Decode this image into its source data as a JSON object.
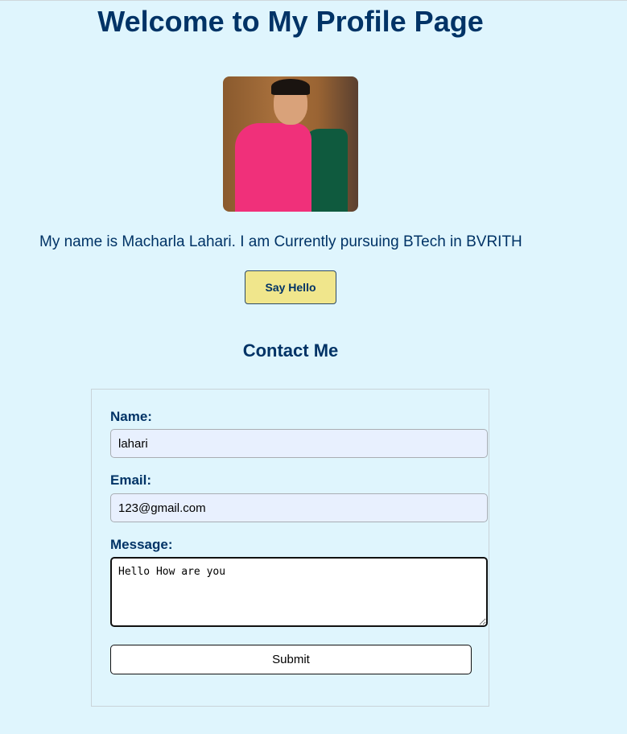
{
  "header": {
    "title": "Welcome to My Profile Page"
  },
  "profile": {
    "photo_alt": "Profile photo",
    "bio": "My name is Macharla Lahari. I am Currently pursuing BTech in BVRITH",
    "hello_label": "Say Hello"
  },
  "contact": {
    "title": "Contact Me",
    "name_label": "Name:",
    "name_value": "lahari",
    "email_label": "Email:",
    "email_value": "123@gmail.com",
    "message_label": "Message:",
    "message_value": "Hello How are you",
    "submit_label": "Submit"
  },
  "colors": {
    "background": "#dff5fd",
    "heading": "#003366",
    "button": "#f0e68c"
  }
}
